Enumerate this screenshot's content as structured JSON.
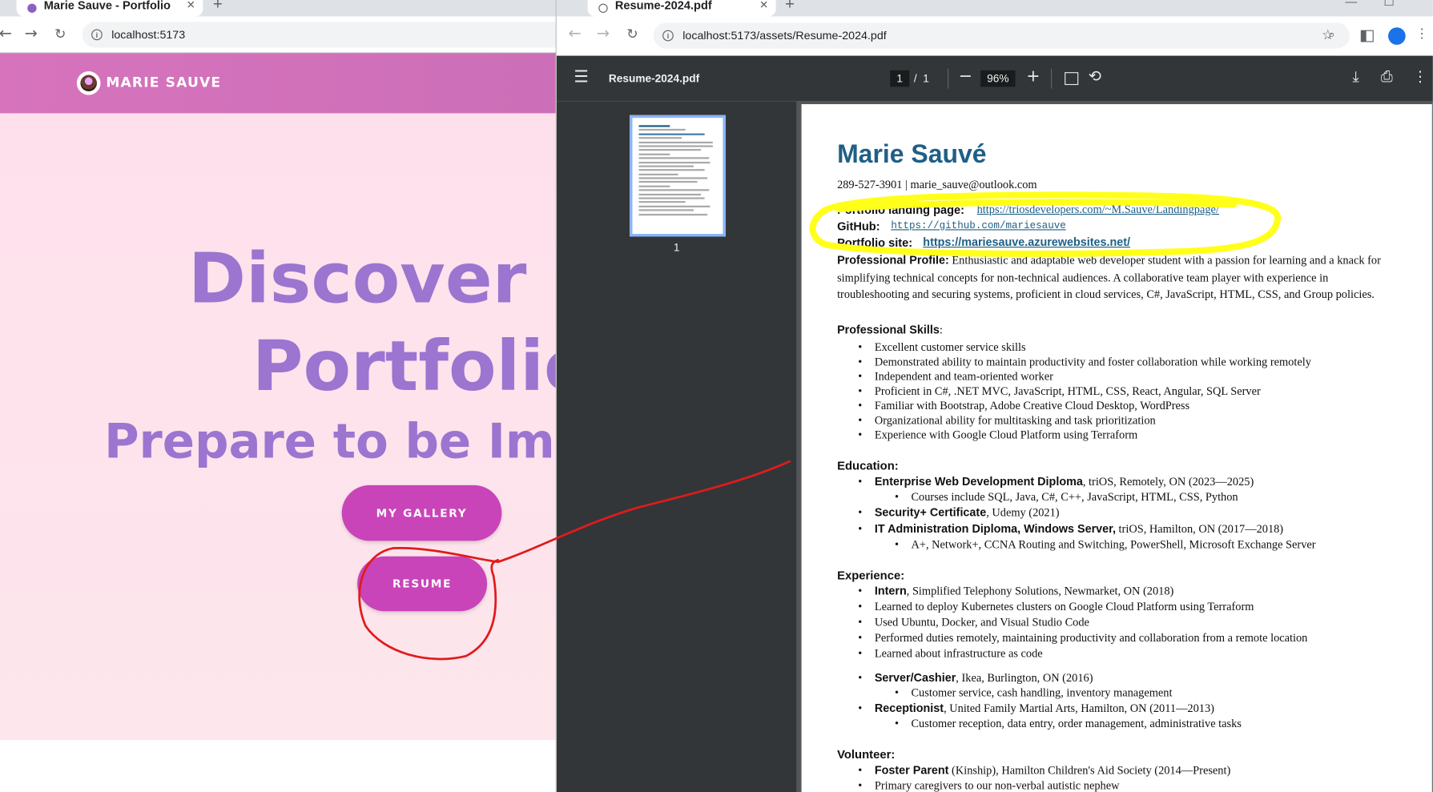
{
  "left_window": {
    "tab_title": "Marie Sauve - Portfolio",
    "url": "localhost:5173",
    "brand": "MARIE SAUVE",
    "hero_line1": "Discover M",
    "hero_line2": "Portfolio",
    "hero_line3": "Prepare to be Imp",
    "btn_gallery": "MY GALLERY",
    "btn_resume": "RESUME"
  },
  "right_window": {
    "tab_title": "Resume-2024.pdf",
    "url": "localhost:5173/assets/Resume-2024.pdf",
    "pdf_title": "Resume-2024.pdf",
    "page_current": "1",
    "page_sep": "/",
    "page_total": "1",
    "zoom": "96%",
    "thumb_label": "1"
  },
  "resume": {
    "name": "Marie Sauvé",
    "contact": "289-527-3901 | marie_sauve@outlook.com",
    "portfolio_landing_label": "Portfolio landing page:",
    "portfolio_landing_url": "https://triosdevelopers.com/~M.Sauve/Landingpage/",
    "github_label": "GitHub:",
    "github_url": "https://github.com/mariesauve",
    "portfolio_site_label": "Portfolio site:",
    "portfolio_site_url": "https://mariesauve.azurewebsites.net/",
    "profile_label": "Professional Profile:",
    "profile_text": "Enthusiastic and adaptable web developer student with a passion for learning and a knack for simplifying technical concepts for non-technical audiences. A collaborative team player with experience in troubleshooting and securing systems, proficient in cloud services, C#, JavaScript, HTML, CSS, and Group policies.",
    "skills_label": "Professional Skills",
    "skills_colon": ":",
    "skills": [
      "Excellent customer service skills",
      "Demonstrated ability to maintain productivity and foster collaboration while working remotely",
      "Independent and team-oriented worker",
      "Proficient in C#, .NET MVC, JavaScript, HTML, CSS, React, Angular, SQL Server",
      "Familiar with Bootstrap, Adobe Creative Cloud Desktop, WordPress",
      "Organizational ability for multitasking and task prioritization",
      "Experience with Google Cloud Platform using Terraform"
    ],
    "education_label": "Education:",
    "edu1_title": "Enterprise Web Development Diploma",
    "edu1_rest": ", triOS, Remotely, ON (2023—2025)",
    "edu1_sub": "Courses include SQL, Java, C#, C++, JavaScript, HTML, CSS, Python",
    "edu2_title": "Security+ Certificate",
    "edu2_rest": ", Udemy (2021)",
    "edu3_title": "IT Administration Diploma, Windows Server,",
    "edu3_rest": " triOS, Hamilton, ON (2017—2018)",
    "edu3_sub": "A+, Network+, CCNA Routing and Switching, PowerShell, Microsoft Exchange Server",
    "experience_label": "Experience:",
    "exp1_title": "Intern",
    "exp1_rest": ", Simplified Telephony Solutions, Newmarket, ON (2018)",
    "exp1_items": [
      "Learned to deploy Kubernetes clusters on Google Cloud Platform using Terraform",
      "Used Ubuntu, Docker, and Visual Studio Code",
      "Performed duties remotely, maintaining productivity and collaboration from a remote location",
      "Learned about infrastructure as code"
    ],
    "exp2_title": "Server/Cashier",
    "exp2_rest": ", Ikea, Burlington, ON (2016)",
    "exp2_sub": "Customer service, cash handling, inventory management",
    "exp3_title": "Receptionist",
    "exp3_rest": ", United Family Martial Arts, Hamilton, ON (2011—2013)",
    "exp3_sub": "Customer reception, data entry, order management, administrative tasks",
    "volunteer_label": "Volunteer:",
    "vol1_title": "Foster Parent",
    "vol1_rest": " (Kinship), Hamilton Children's Aid Society (2014—Present)",
    "vol1_sub": "Primary caregivers to our non-verbal autistic nephew"
  },
  "colors": {
    "pdf_toolbar": "#323639",
    "pdf_viewer_bg": "#525659",
    "site_header": "#d773bd",
    "hero_text": "#9b75d0",
    "button": "#c944b9",
    "link": "#1f5f86",
    "highlight_yellow": "#ffff1a",
    "annotation_red": "#e01b1b"
  }
}
